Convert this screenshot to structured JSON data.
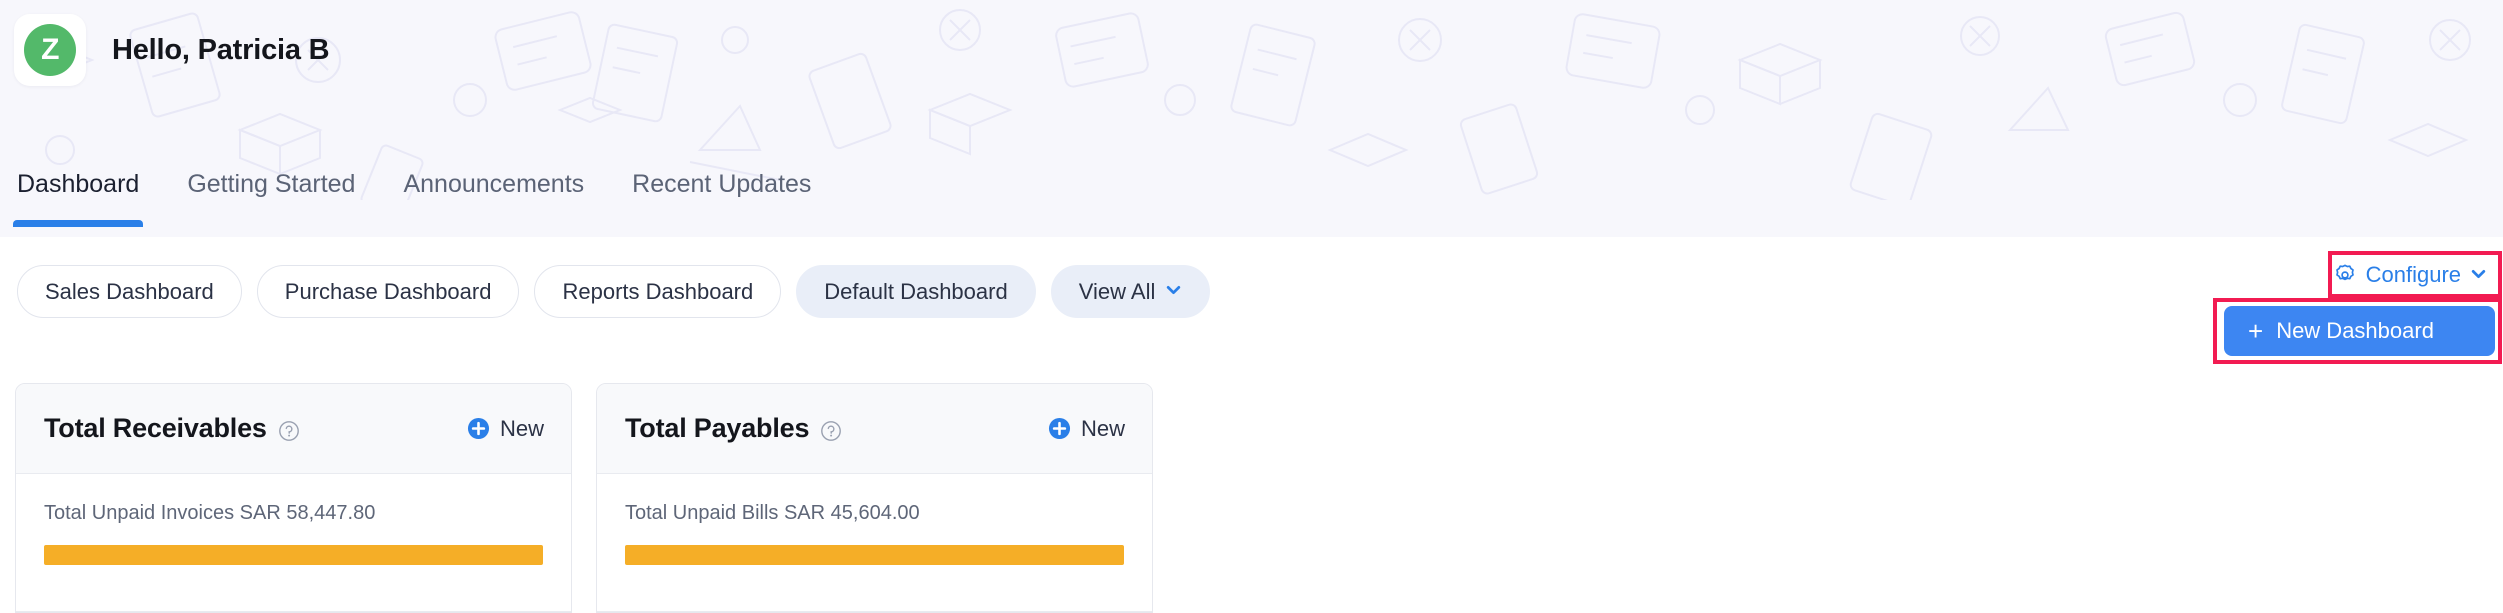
{
  "header": {
    "avatar_initial": "Z",
    "greeting": "Hello, Patricia B"
  },
  "tabs": [
    {
      "label": "Dashboard",
      "active": true
    },
    {
      "label": "Getting Started",
      "active": false
    },
    {
      "label": "Announcements",
      "active": false
    },
    {
      "label": "Recent Updates",
      "active": false
    }
  ],
  "dashboard_pills": [
    {
      "label": "Sales Dashboard",
      "selected": false
    },
    {
      "label": "Purchase Dashboard",
      "selected": false
    },
    {
      "label": "Reports Dashboard",
      "selected": false
    },
    {
      "label": "Default Dashboard",
      "selected": true
    },
    {
      "label": "View All",
      "selected": true,
      "has_chevron": true
    }
  ],
  "configure": {
    "label": "Configure",
    "icon": "gear-icon",
    "chevron": "chevron-down-icon"
  },
  "dropdown": {
    "items": [
      {
        "label": "New Dashboard",
        "prefix": "+",
        "highlighted": true
      }
    ]
  },
  "cards": [
    {
      "title": "Total Receivables",
      "help_icon": "help-circle-icon",
      "new_label": "New",
      "new_icon": "plus-circle-icon",
      "subtitle": "Total Unpaid Invoices SAR 58,447.80",
      "bar_percent": 100
    },
    {
      "title": "Total Payables",
      "help_icon": "help-circle-icon",
      "new_label": "New",
      "new_icon": "plus-circle-icon",
      "subtitle": "Total Unpaid Bills SAR 45,604.00",
      "bar_percent": 100
    }
  ],
  "colors": {
    "accent_blue": "#2a7fe8",
    "highlight_blue": "#3d86f2",
    "annotation_red": "#f21b52",
    "bar_orange": "#f5ae27",
    "avatar_green": "#53b96a"
  }
}
